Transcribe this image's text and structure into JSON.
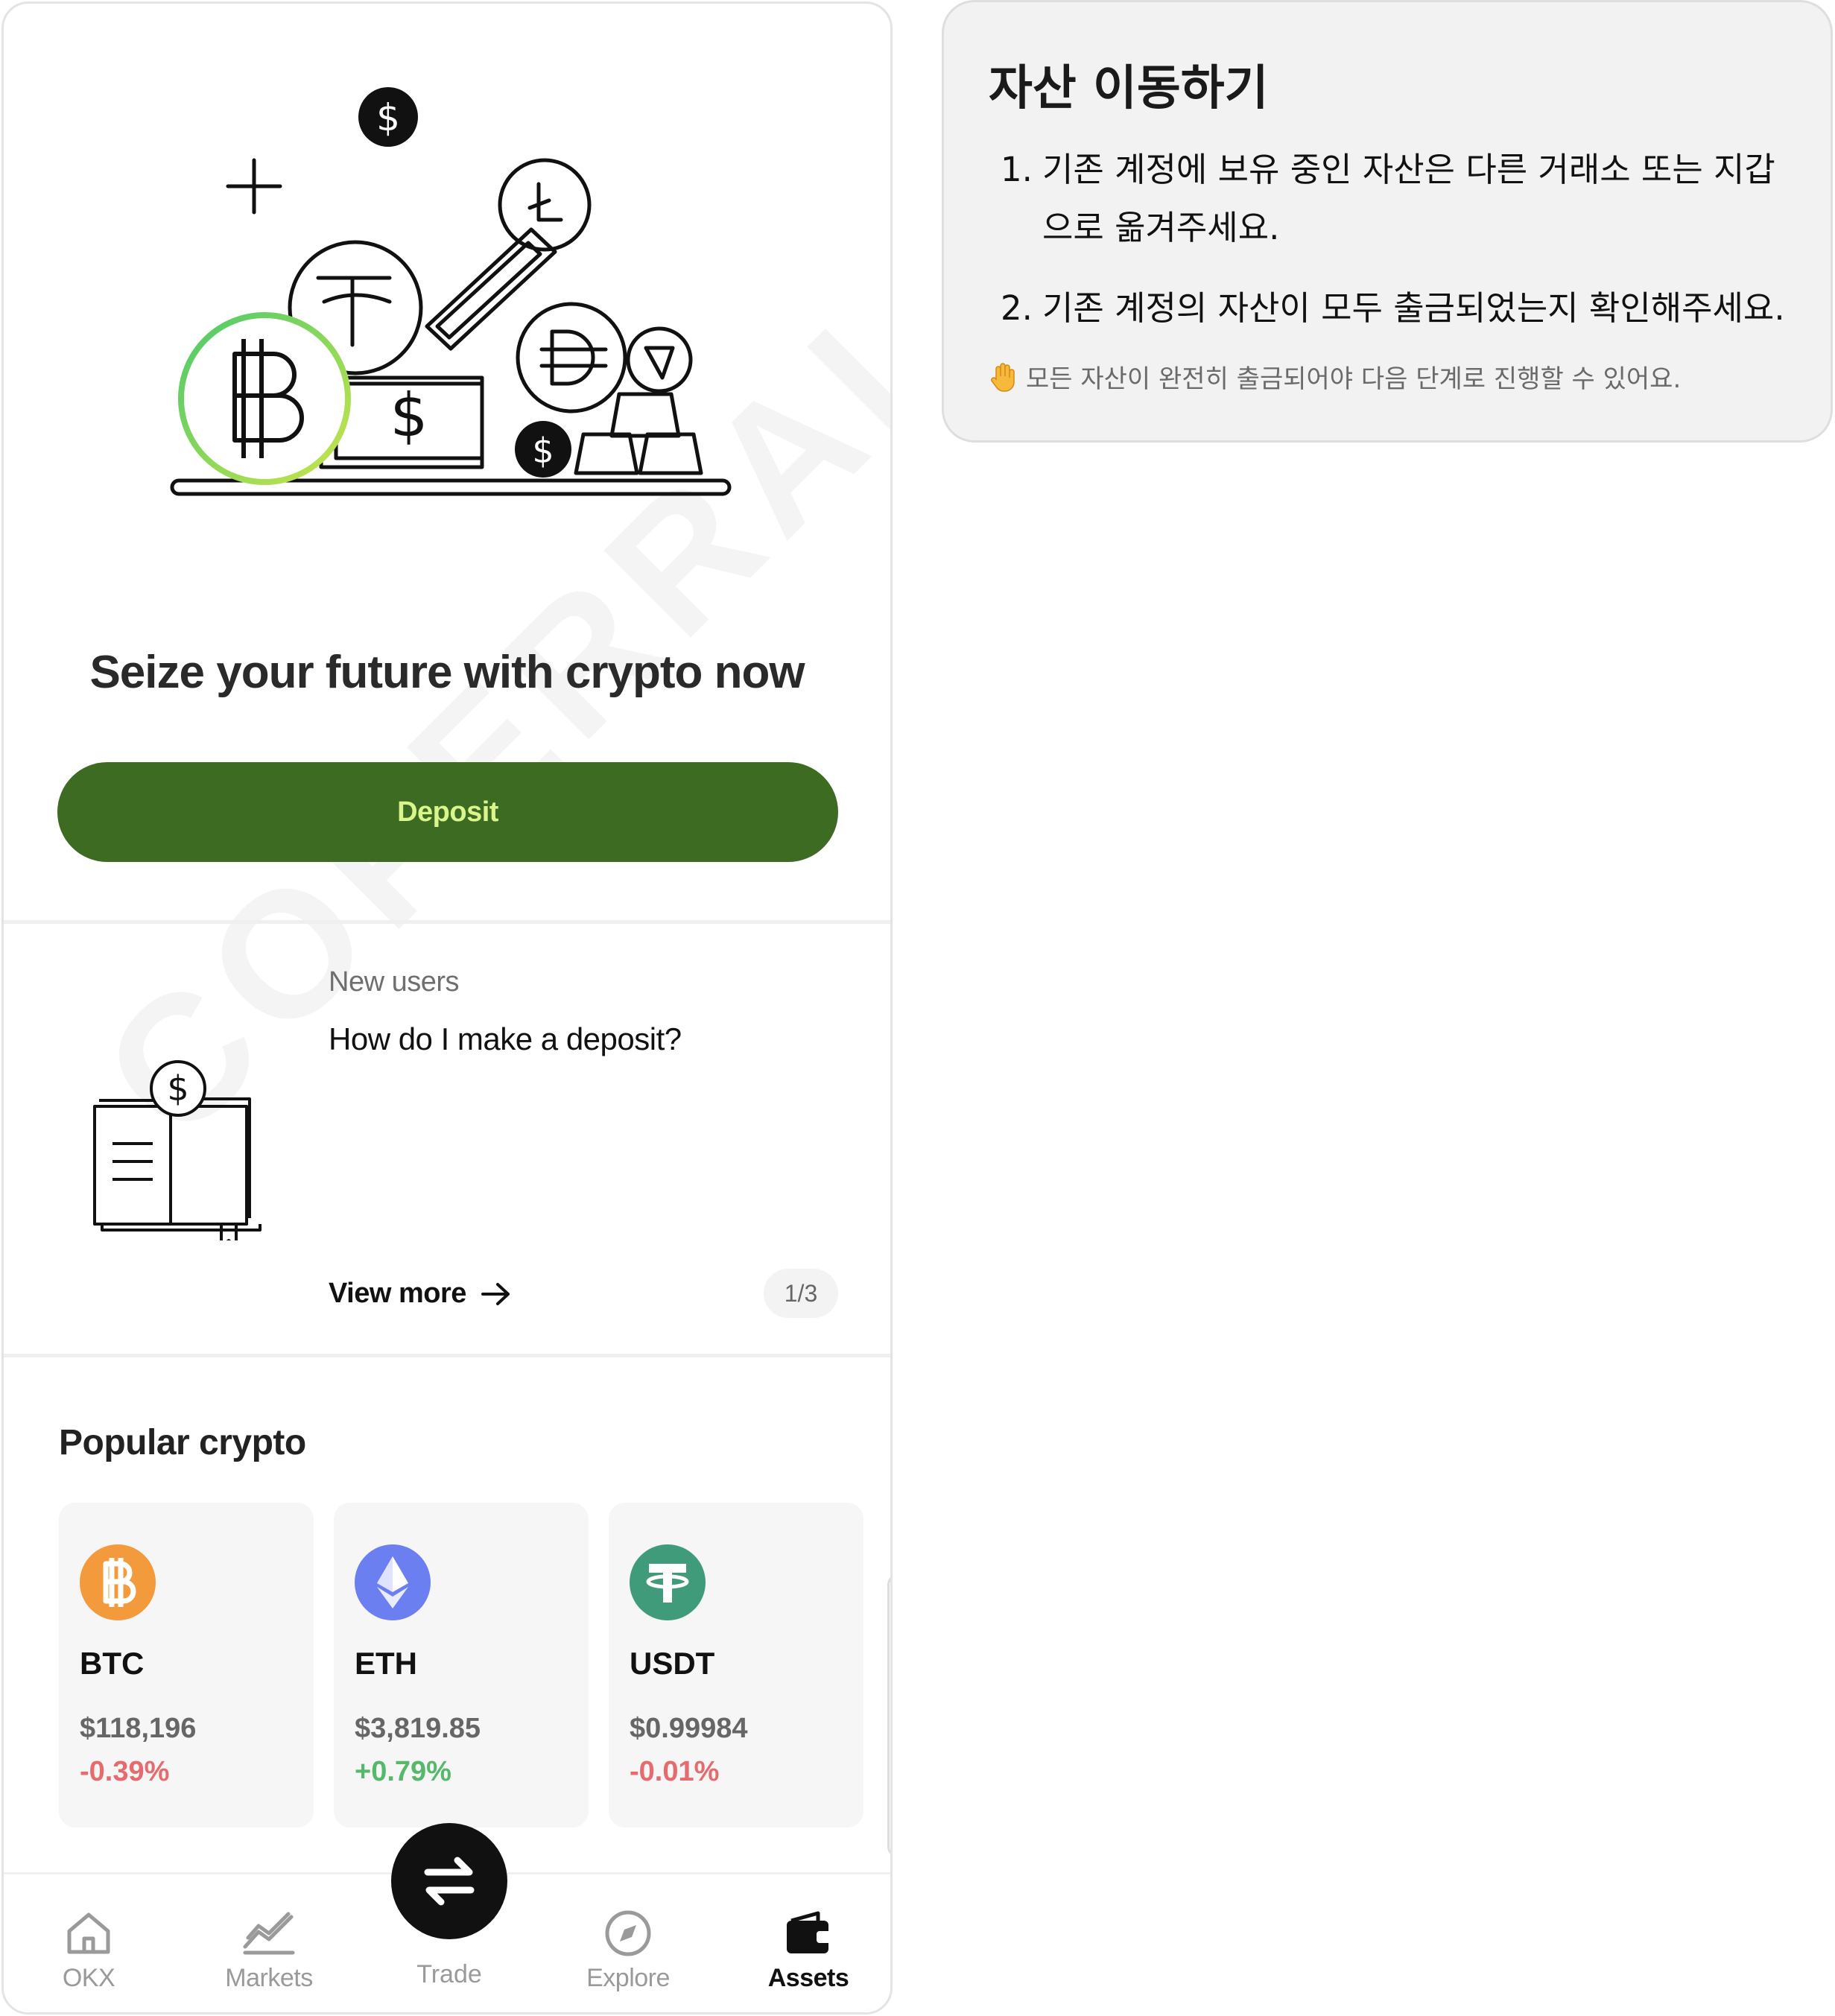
{
  "hero": {
    "headline": "Seize your future with crypto now",
    "deposit_label": "Deposit"
  },
  "guide": {
    "tag": "New users",
    "title": "How do I make a deposit?",
    "view_more": "View more",
    "pager": "1/3"
  },
  "popular": {
    "title": "Popular crypto",
    "coins": [
      {
        "symbol": "BTC",
        "price": "$118,196",
        "change": "-0.39%",
        "icon": "bitcoin-icon",
        "color": "#f39a3d"
      },
      {
        "symbol": "ETH",
        "price": "$3,819.85",
        "change": "+0.79%",
        "icon": "ethereum-icon",
        "color": "#6c7ff0"
      },
      {
        "symbol": "USDT",
        "price": "$0.99984",
        "change": "-0.01%",
        "icon": "tether-icon",
        "color": "#3f9b7a"
      }
    ]
  },
  "tabbar": {
    "tabs": [
      {
        "label": "OKX",
        "icon": "home-icon"
      },
      {
        "label": "Markets",
        "icon": "markets-chart-icon"
      },
      {
        "label": "Trade",
        "icon": "swap-icon"
      },
      {
        "label": "Explore",
        "icon": "compass-icon"
      },
      {
        "label": "Assets",
        "icon": "wallet-icon",
        "active": true
      }
    ]
  },
  "watermark": "COPERRAL",
  "note": {
    "title": "자산 이동하기",
    "steps": [
      {
        "num": "1.",
        "text": "기존 계정에 보유 중인 자산은 다른 거래소 또는 지갑으로 옮겨주세요."
      },
      {
        "num": "2.",
        "text": "기존 계정의 자산이 모두 출금되었는지 확인해주세요."
      }
    ],
    "hint": "모든 자산이 완전히 출금되어야 다음 단계로 진행할 수 있어요.",
    "hint_icon": "raised-hand-icon"
  },
  "colors": {
    "deposit_bg": "#3d6b21",
    "deposit_text": "#d9f58c",
    "negative": "#e56b6f",
    "positive": "#55b86a"
  }
}
